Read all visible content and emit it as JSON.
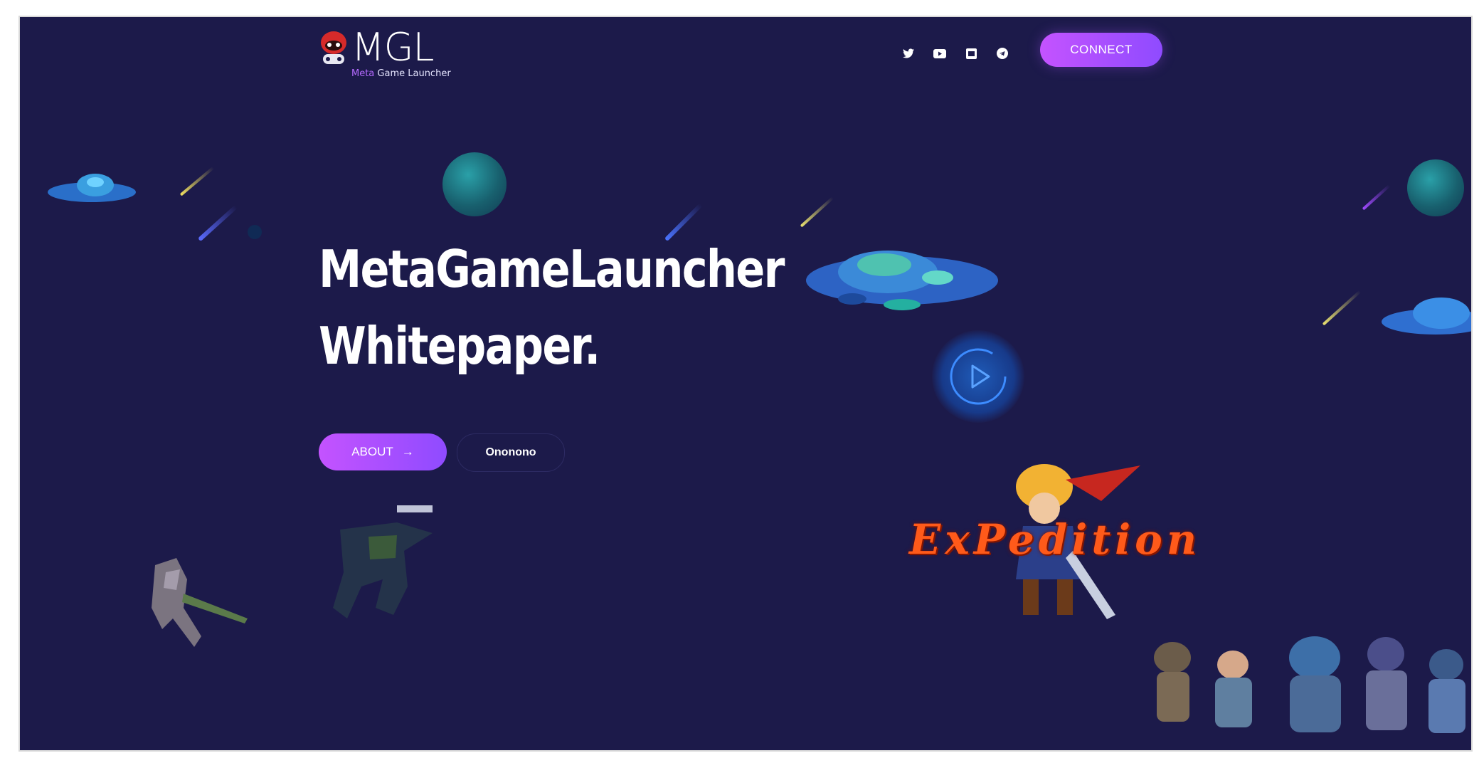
{
  "header": {
    "logo_text": "MGL",
    "tagline_accent": "Meta",
    "tagline_rest": " Game Launcher",
    "social_icons": [
      "twitter-icon",
      "youtube-icon",
      "medium-icon",
      "telegram-icon"
    ],
    "connect_label": "CONNECT"
  },
  "hero": {
    "title_line1": "MetaGameLauncher",
    "title_line2": "Whitepaper.",
    "about_label": "ABOUT",
    "about_arrow": "→",
    "secondary_label": "Ononono"
  },
  "game_logo": {
    "text": "ExPedition"
  },
  "colors": {
    "background": "#1c1a4a",
    "accent_start": "#c453ff",
    "accent_end": "#8f4bff",
    "play_blue": "#3d8cff"
  }
}
